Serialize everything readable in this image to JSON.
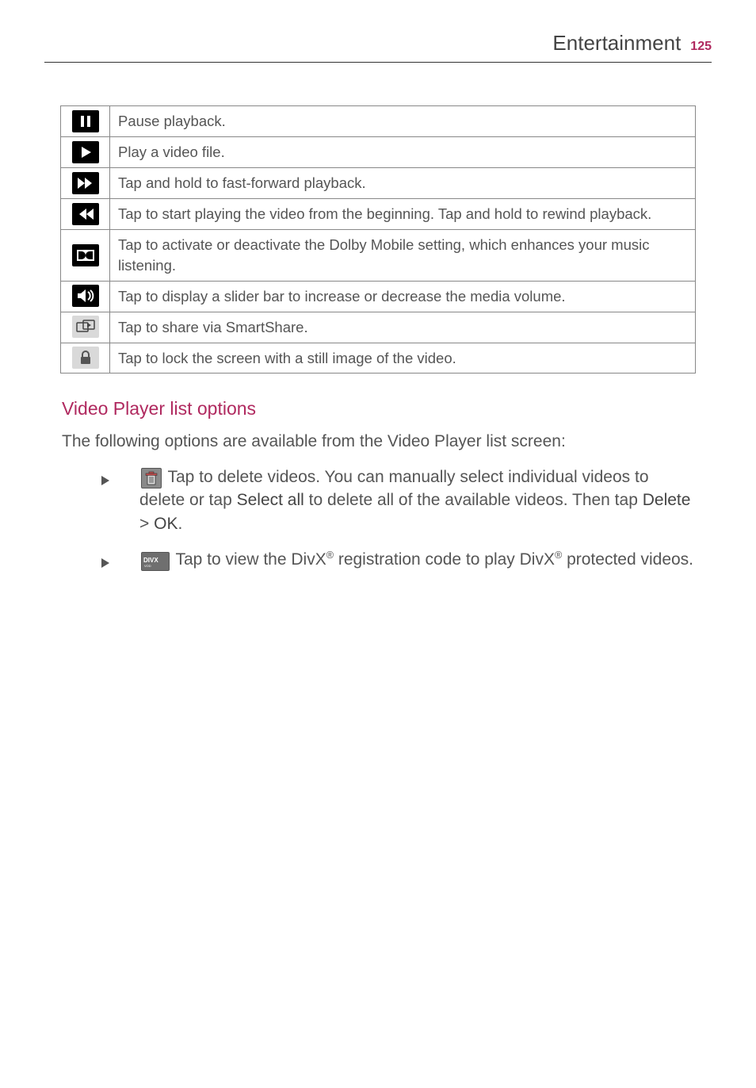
{
  "header": {
    "section": "Entertainment",
    "page": "125"
  },
  "table": {
    "rows": [
      {
        "icon": "pause-icon",
        "text": "Pause playback."
      },
      {
        "icon": "play-icon",
        "text": "Play a video file."
      },
      {
        "icon": "fast-forward-icon",
        "text": "Tap and hold to fast-forward playback."
      },
      {
        "icon": "restart-rewind-icon",
        "text": "Tap to start playing the video from the beginning. Tap and hold to rewind playback."
      },
      {
        "icon": "dolby-icon",
        "text": "Tap to activate or deactivate the Dolby Mobile setting, which enhances your music listening."
      },
      {
        "icon": "volume-icon",
        "text": "Tap to display a slider bar to increase or decrease the media volume."
      },
      {
        "icon": "smartshare-icon",
        "text": "Tap to share via SmartShare."
      },
      {
        "icon": "lock-icon",
        "text": "Tap to lock the screen with a still image of the video."
      }
    ]
  },
  "sub": {
    "title": "Video Player list options",
    "intro": "The following options are available from the Video Player list screen:",
    "bullet1_a": " Tap to delete videos. You can manually select individual videos to delete or tap ",
    "bullet1_select": "Select all",
    "bullet1_b": " to delete all of the available videos. Then tap ",
    "bullet1_delete": "Delete",
    "bullet1_gt": " > ",
    "bullet1_ok": "OK",
    "bullet1_dot": ".",
    "bullet2_a": " Tap to view the DivX",
    "bullet2_reg1": "®",
    "bullet2_b": " registration code to play DivX",
    "bullet2_reg2": "®",
    "bullet2_c": " protected videos."
  }
}
